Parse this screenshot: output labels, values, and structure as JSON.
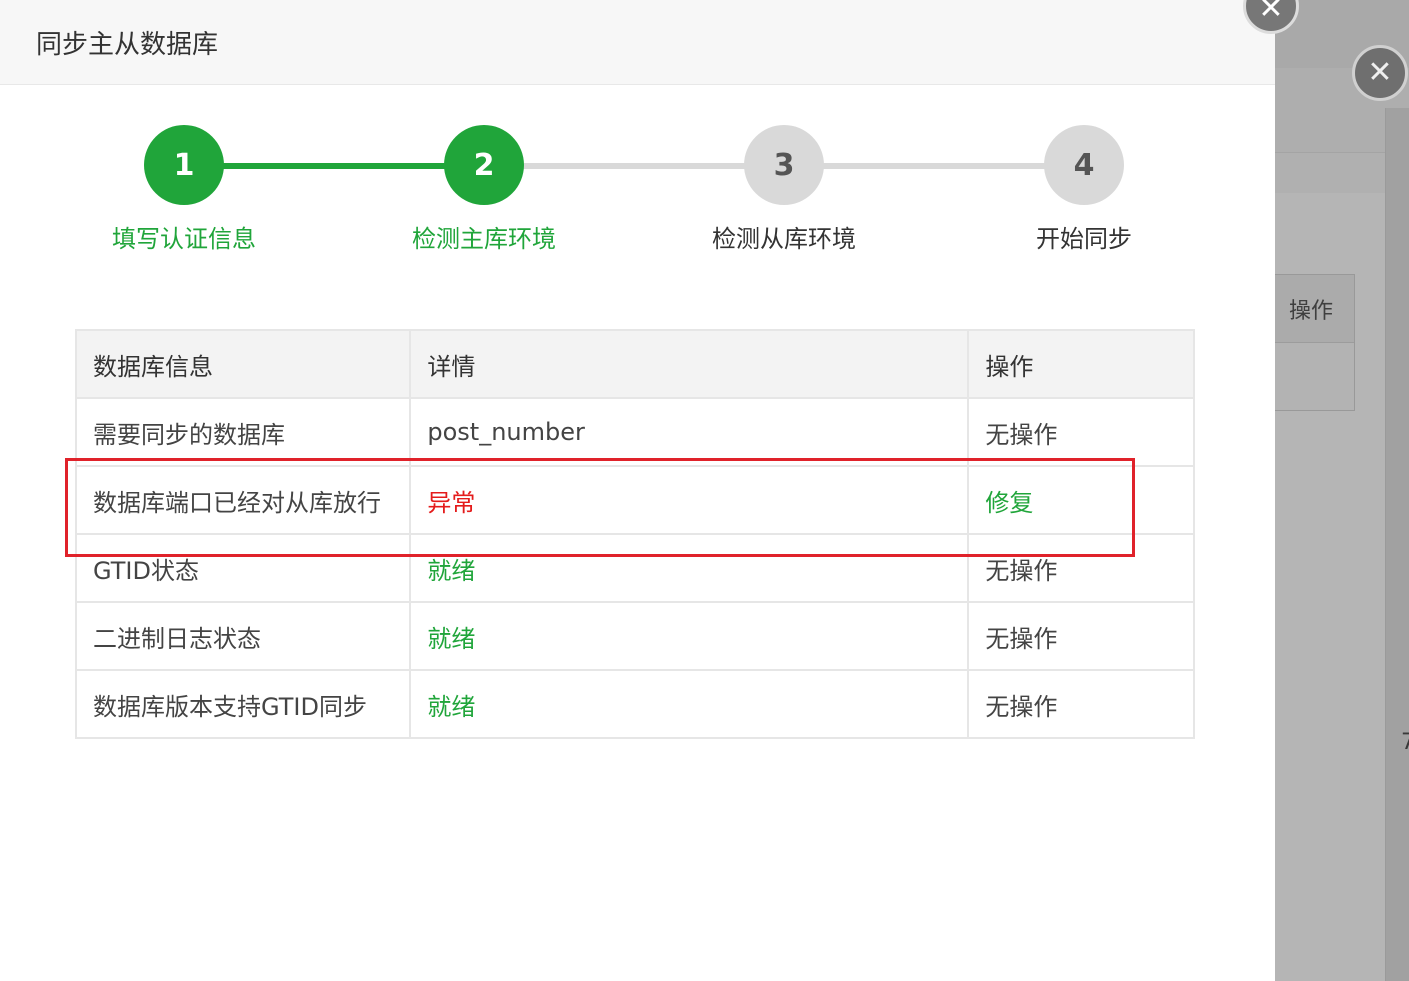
{
  "dialog": {
    "title": "同步主从数据库"
  },
  "colors": {
    "active_green": "#20a53a",
    "inactive_gray": "#d9d9d9",
    "error_red": "#e41b1b",
    "ready_green": "#20a53a",
    "highlight_red": "#e0222a"
  },
  "steps": [
    {
      "number": "1",
      "label": "填写认证信息",
      "state": "done"
    },
    {
      "number": "2",
      "label": "检测主库环境",
      "state": "active"
    },
    {
      "number": "3",
      "label": "检测从库环境",
      "state": "pending"
    },
    {
      "number": "4",
      "label": "开始同步",
      "state": "pending"
    }
  ],
  "table": {
    "headers": [
      "数据库信息",
      "详情",
      "操作"
    ],
    "rows": [
      {
        "info": "需要同步的数据库",
        "detail": "post_number",
        "detail_status": "plain",
        "action": "无操作",
        "action_type": "plain"
      },
      {
        "info": "数据库端口已经对从库放行",
        "detail": "异常",
        "detail_status": "error",
        "action": "修复",
        "action_type": "link"
      },
      {
        "info": "GTID状态",
        "detail": "就绪",
        "detail_status": "ready",
        "action": "无操作",
        "action_type": "plain"
      },
      {
        "info": "二进制日志状态",
        "detail": "就绪",
        "detail_status": "ready",
        "action": "无操作",
        "action_type": "plain"
      },
      {
        "info": "数据库版本支持GTID同步",
        "detail": "就绪",
        "detail_status": "ready",
        "action": "无操作",
        "action_type": "plain"
      }
    ]
  },
  "background_dialog": {
    "column_header": "操作",
    "partial_number": "7"
  },
  "icons": {
    "close": "close-icon"
  }
}
